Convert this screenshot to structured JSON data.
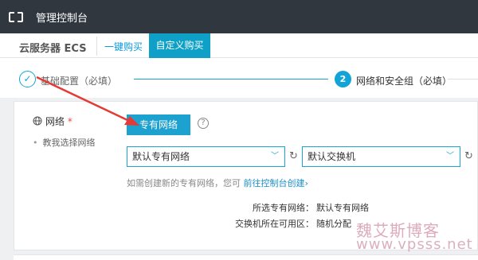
{
  "topbar": {
    "logo_icon": "aliyun-logo-icon",
    "title": "管理控制台"
  },
  "tabs": {
    "product": "云服务器 ECS",
    "quick_buy": "一键购买",
    "custom_buy": "自定义购买"
  },
  "steps": {
    "step1_label": "基础配置（必填）",
    "step1_icon": "check-icon",
    "step2_number": "2",
    "step2_label": "网络和安全组（必填）"
  },
  "network": {
    "label": "网络",
    "required_mark": "*",
    "help_link": "教我选择网络",
    "vpc_button": "专有网络",
    "help_icon": "?",
    "vpc_select": "默认专有网络",
    "switch_select": "默认交换机",
    "hint_text": "如需创建新的专有网络，您可",
    "hint_link": "前往控制台创建›",
    "selected_vpc_label": "所选专有网络：",
    "selected_vpc_value": "默认专有网络",
    "zone_label": "交换机所在可用区：",
    "zone_value": "随机分配"
  },
  "watermark": {
    "text": "魏艾斯博客",
    "url": "www.vpsss.net"
  },
  "colors": {
    "accent": "#1da1cf",
    "topbar": "#30373f",
    "arrow": "#e53935"
  }
}
